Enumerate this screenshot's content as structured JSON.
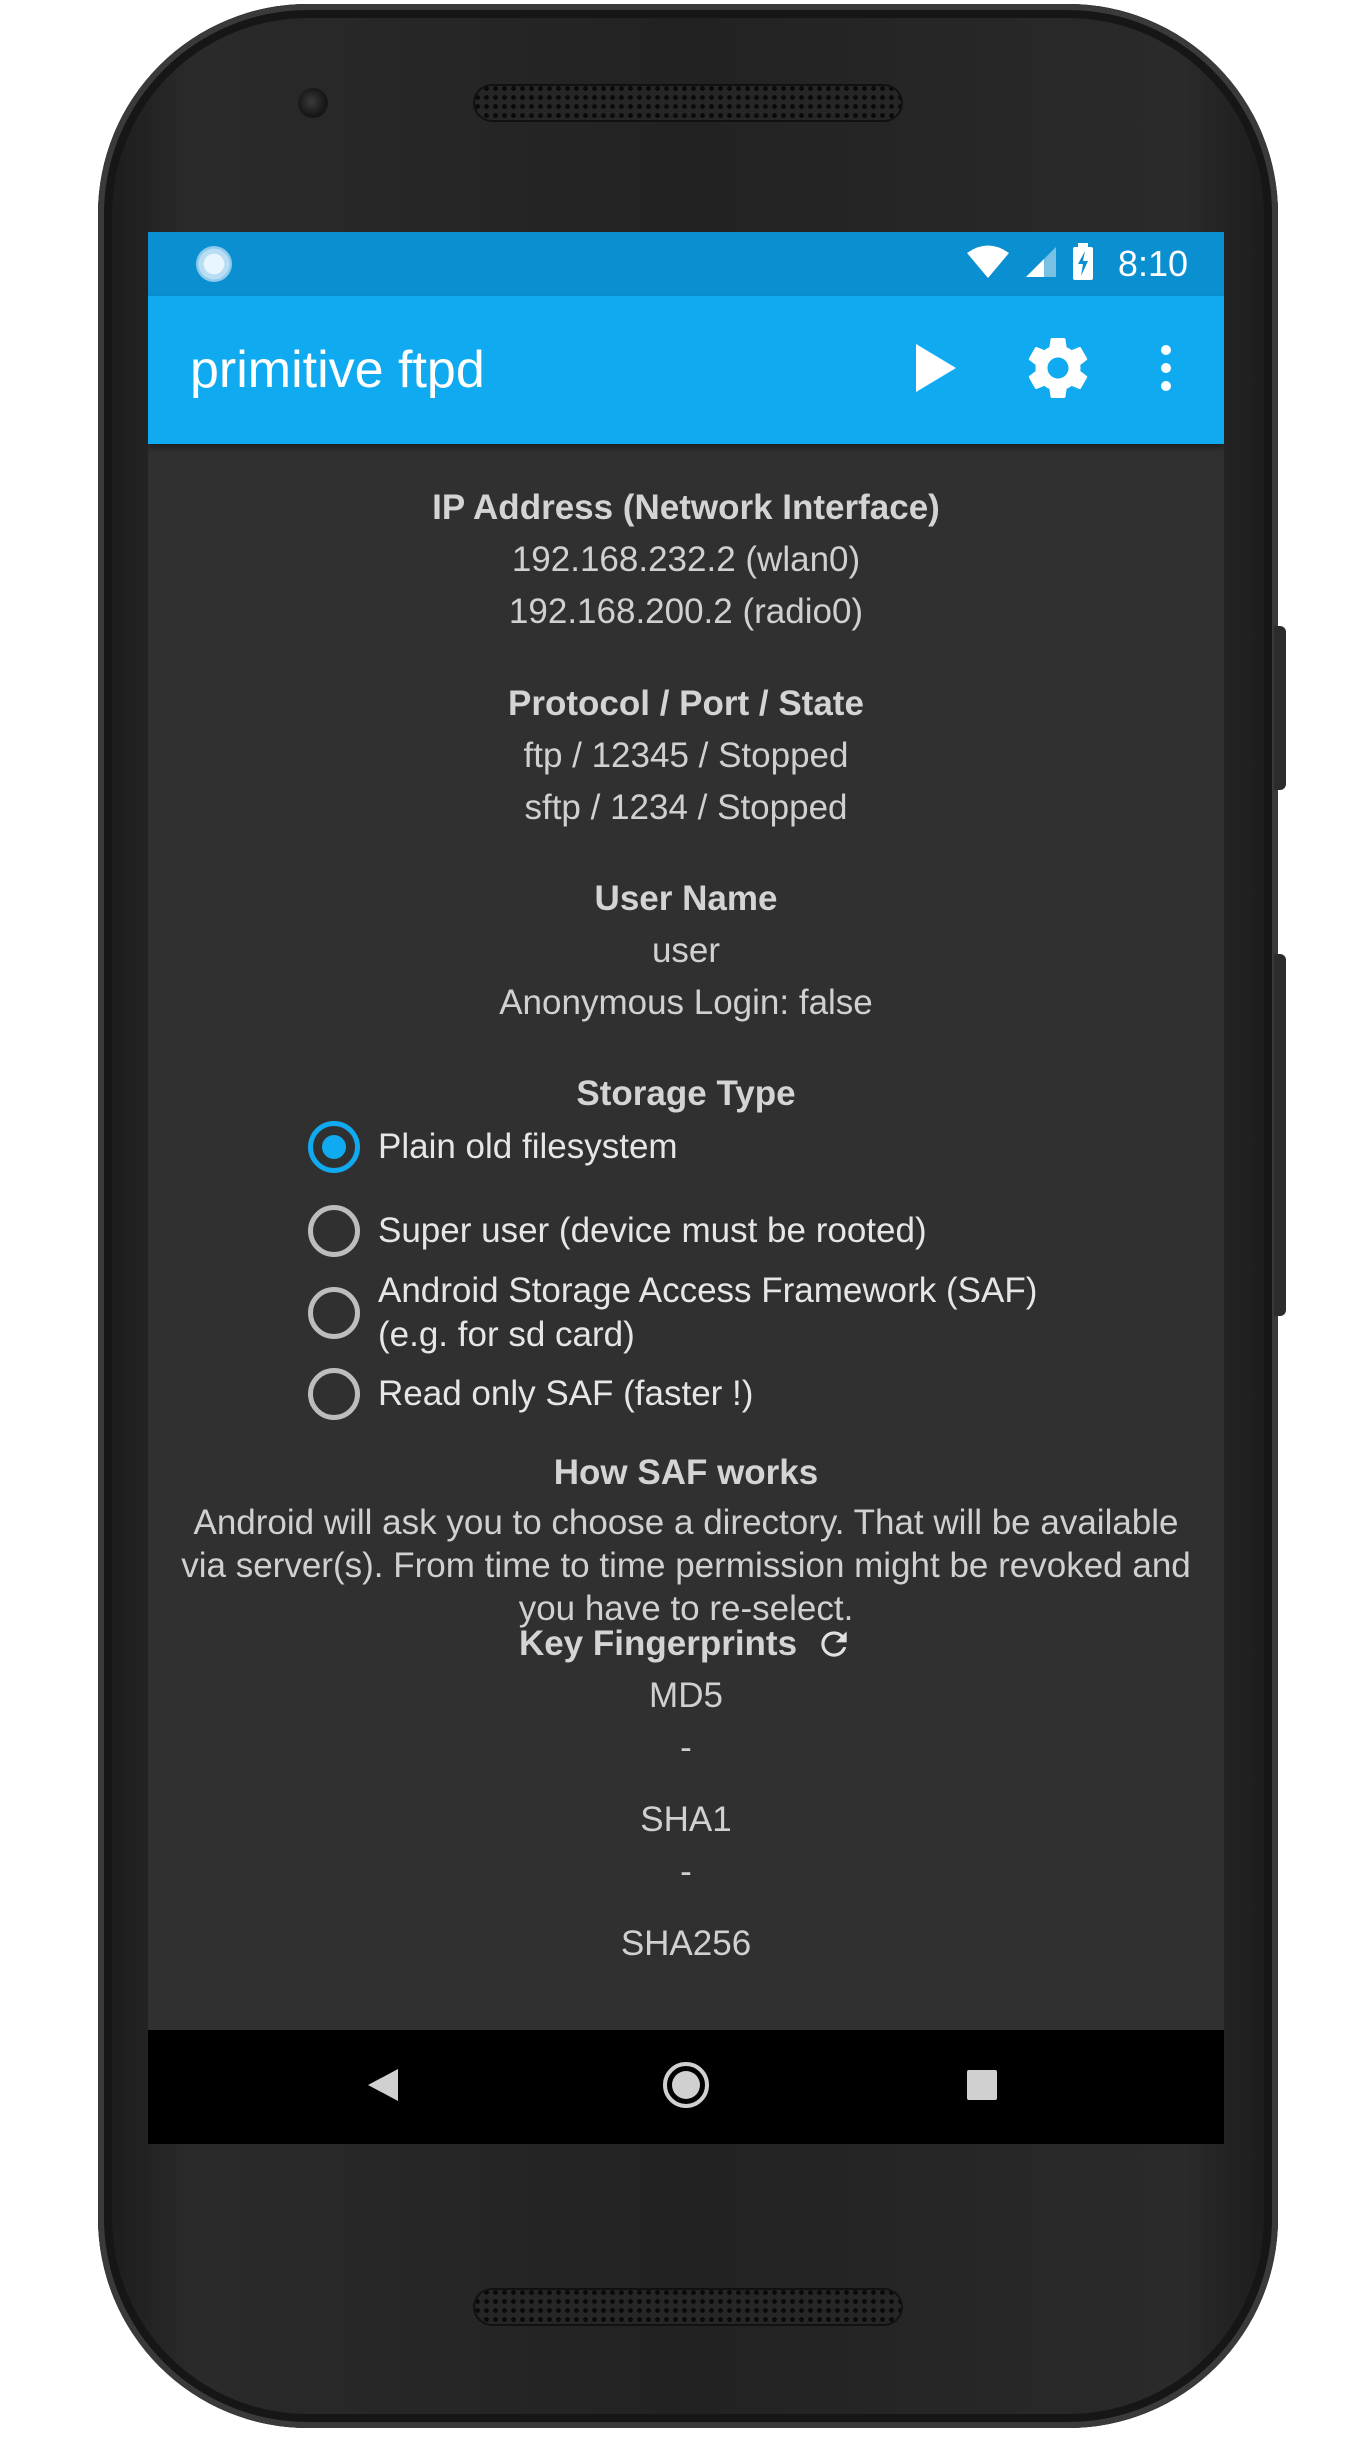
{
  "status_bar": {
    "time": "8:10",
    "icons": [
      "notification-icon",
      "wifi-icon",
      "signal-icon",
      "battery-charging-icon"
    ]
  },
  "app_bar": {
    "title": "primitive ftpd",
    "actions": [
      "play-icon",
      "gear-icon",
      "more-vert-icon"
    ],
    "color": "#10aaf0"
  },
  "ip": {
    "heading": "IP Address (Network Interface)",
    "lines": [
      "192.168.232.2 (wlan0)",
      "192.168.200.2 (radio0)"
    ]
  },
  "protocol": {
    "heading": "Protocol / Port / State",
    "lines": [
      "ftp / 12345 / Stopped",
      "sftp / 1234 / Stopped"
    ]
  },
  "user": {
    "heading": "User Name",
    "lines": [
      "user",
      "Anonymous Login: false"
    ]
  },
  "storage": {
    "heading": "Storage Type",
    "options": [
      {
        "label": "Plain old filesystem",
        "checked": true
      },
      {
        "label": "Super user (device must be rooted)",
        "checked": false
      },
      {
        "label": "Android Storage Access Framework (SAF)",
        "label2": "(e.g. for sd card)",
        "checked": false
      },
      {
        "label": "Read only SAF (faster !)",
        "checked": false
      }
    ]
  },
  "saf": {
    "heading": "How SAF works",
    "lines": [
      "Android will ask you to choose a directory. That will be available",
      "via server(s). From time to time permission might be revoked and",
      "you have to re-select."
    ]
  },
  "fingerprints": {
    "heading": "Key Fingerprints",
    "refresh_icon": "refresh-icon",
    "md5_label": "MD5",
    "md5_value": "-",
    "sha1_label": "SHA1",
    "sha1_value": "-",
    "sha256_label": "SHA256"
  },
  "nav_bar": {
    "buttons": [
      "back-icon",
      "home-icon",
      "recents-icon"
    ]
  }
}
